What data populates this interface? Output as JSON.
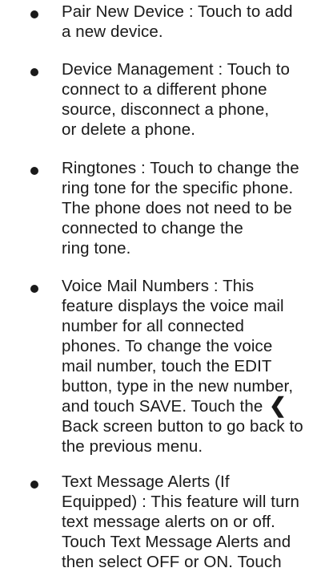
{
  "items": [
    {
      "lines": [
        "Pair New Device : Touch to add",
        "a new device."
      ]
    },
    {
      "lines": [
        "Device Management : Touch to",
        "connect to a different phone",
        "source, disconnect a phone,",
        "or delete a phone."
      ]
    },
    {
      "lines": [
        "Ringtones : Touch to change the",
        "ring tone for the specific phone.",
        "The phone does not need to be",
        "connected to change the",
        "ring tone."
      ]
    },
    {
      "lines": [
        "Voice Mail Numbers : This",
        "feature displays the voice mail",
        "number for all connected",
        "phones. To change the voice",
        "mail number, touch the EDIT",
        "button, type in the new number,",
        "and touch SAVE. Touch the ",
        "Back screen button to go back to",
        "the previous menu."
      ],
      "back_glyph": "❮"
    },
    {
      "lines": [
        "Text Message Alerts (If",
        "Equipped) : This feature will turn",
        "text message alerts on or off.",
        "Touch Text Message Alerts and",
        "then select OFF or ON. Touch"
      ]
    }
  ],
  "icons": {
    "bullet": "bullet-dot",
    "back": "back-chevron-icon"
  }
}
